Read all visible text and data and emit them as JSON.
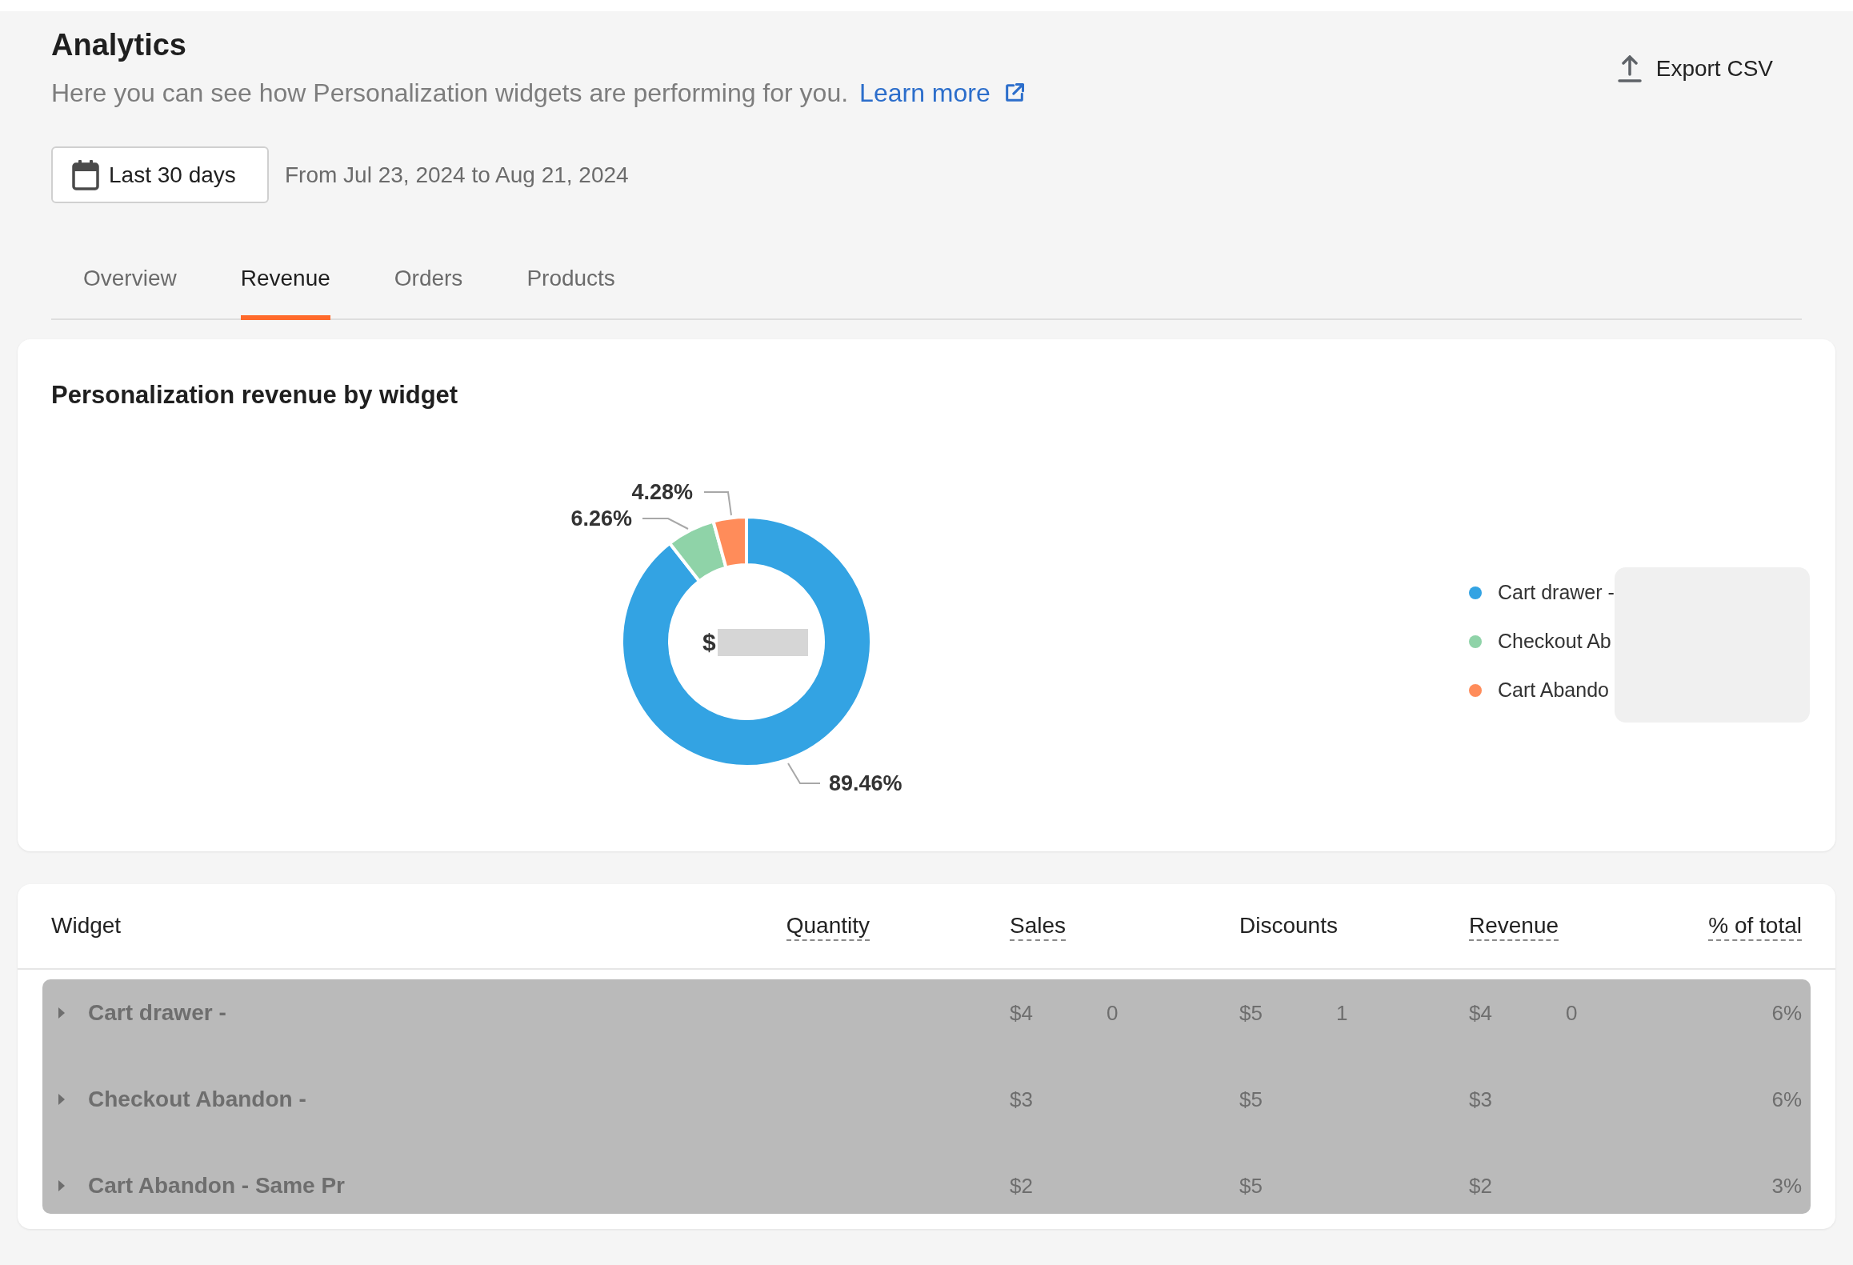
{
  "header": {
    "title": "Analytics",
    "subtitle": "Here you can see how Personalization widgets are performing for you.",
    "learn_more": "Learn more",
    "export_button": "Export CSV"
  },
  "date_filter": {
    "button": "Last 30 days",
    "range": "From Jul 23, 2024 to Aug 21, 2024"
  },
  "tabs": [
    {
      "label": "Overview",
      "selected": false
    },
    {
      "label": "Revenue",
      "selected": true
    },
    {
      "label": "Orders",
      "selected": false
    },
    {
      "label": "Products",
      "selected": false
    }
  ],
  "revenue_card": {
    "title": "Personalization revenue by widget",
    "center_label": "$",
    "chart_data": {
      "type": "donut",
      "categories": [
        "Cart drawer -",
        "Checkout Ab",
        "Cart Abando"
      ],
      "series": [
        {
          "values": [
            89.46,
            6.26,
            4.28
          ]
        }
      ],
      "colors": [
        "#33a3e3",
        "#8fd3a8",
        "#ff8c5a"
      ],
      "legend": true,
      "value_labels": [
        "89.46%",
        "6.26%",
        "4.28%"
      ]
    }
  },
  "table": {
    "columns": [
      {
        "label": "Widget",
        "dashed": false
      },
      {
        "label": "Quantity",
        "dashed": true
      },
      {
        "label": "Sales",
        "dashed": true
      },
      {
        "label": "Discounts",
        "dashed": false
      },
      {
        "label": "Revenue",
        "dashed": true
      },
      {
        "label": "% of total",
        "dashed": true
      }
    ],
    "rows": [
      {
        "widget": "Cart drawer -",
        "sales": [
          "$4",
          "0"
        ],
        "discounts": [
          "$5",
          "1"
        ],
        "revenue": [
          "$4",
          "0"
        ],
        "percent": "6%"
      },
      {
        "widget": "Checkout Abandon -",
        "sales": [
          "$3"
        ],
        "discounts": [
          "$5"
        ],
        "revenue": [
          "$3"
        ],
        "percent": "6%"
      },
      {
        "widget": "Cart Abandon - Same Pr",
        "sales": [
          "$2"
        ],
        "discounts": [
          "$5"
        ],
        "revenue": [
          "$2"
        ],
        "percent": "3%"
      }
    ]
  }
}
